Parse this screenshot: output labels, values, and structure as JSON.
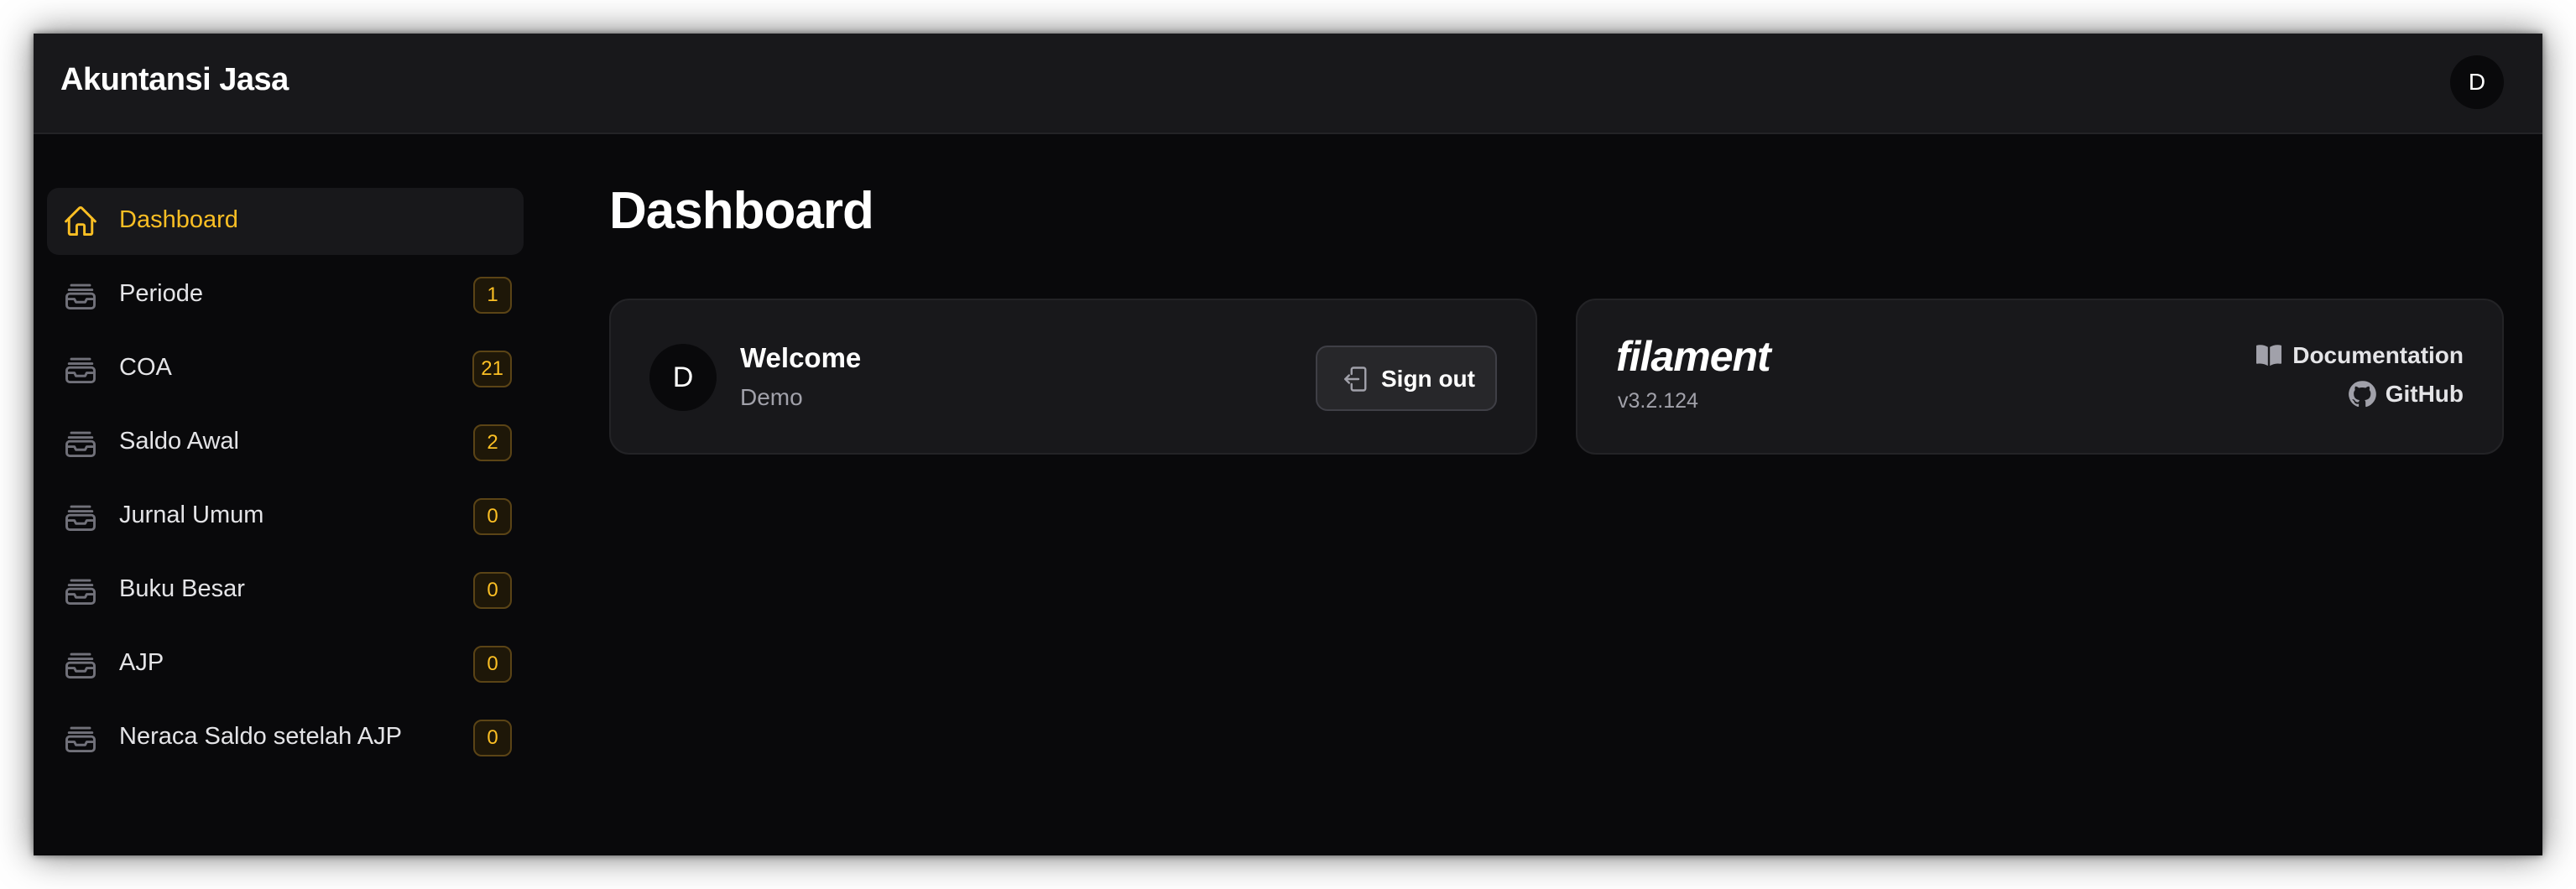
{
  "app": {
    "brand": "Akuntansi Jasa",
    "user_initial": "D"
  },
  "sidebar": {
    "items": [
      {
        "label": "Dashboard",
        "icon": "home-icon",
        "active": true,
        "badge": null
      },
      {
        "label": "Periode",
        "icon": "inbox-stack-icon",
        "active": false,
        "badge": "1"
      },
      {
        "label": "COA",
        "icon": "inbox-stack-icon",
        "active": false,
        "badge": "21"
      },
      {
        "label": "Saldo Awal",
        "icon": "inbox-stack-icon",
        "active": false,
        "badge": "2"
      },
      {
        "label": "Jurnal Umum",
        "icon": "inbox-stack-icon",
        "active": false,
        "badge": "0"
      },
      {
        "label": "Buku Besar",
        "icon": "inbox-stack-icon",
        "active": false,
        "badge": "0"
      },
      {
        "label": "AJP",
        "icon": "inbox-stack-icon",
        "active": false,
        "badge": "0"
      },
      {
        "label": "Neraca Saldo setelah AJP",
        "icon": "inbox-stack-icon",
        "active": false,
        "badge": "0"
      }
    ]
  },
  "main": {
    "title": "Dashboard",
    "welcome_card": {
      "avatar_initial": "D",
      "title": "Welcome",
      "subtitle": "Demo",
      "signout_label": "Sign out"
    },
    "filament_card": {
      "logo_text": "filament",
      "version": "v3.2.124",
      "documentation_label": "Documentation",
      "github_label": "GitHub"
    }
  },
  "colors": {
    "accent": "#fbbf24",
    "background": "#09090b",
    "panel": "#18181b"
  }
}
